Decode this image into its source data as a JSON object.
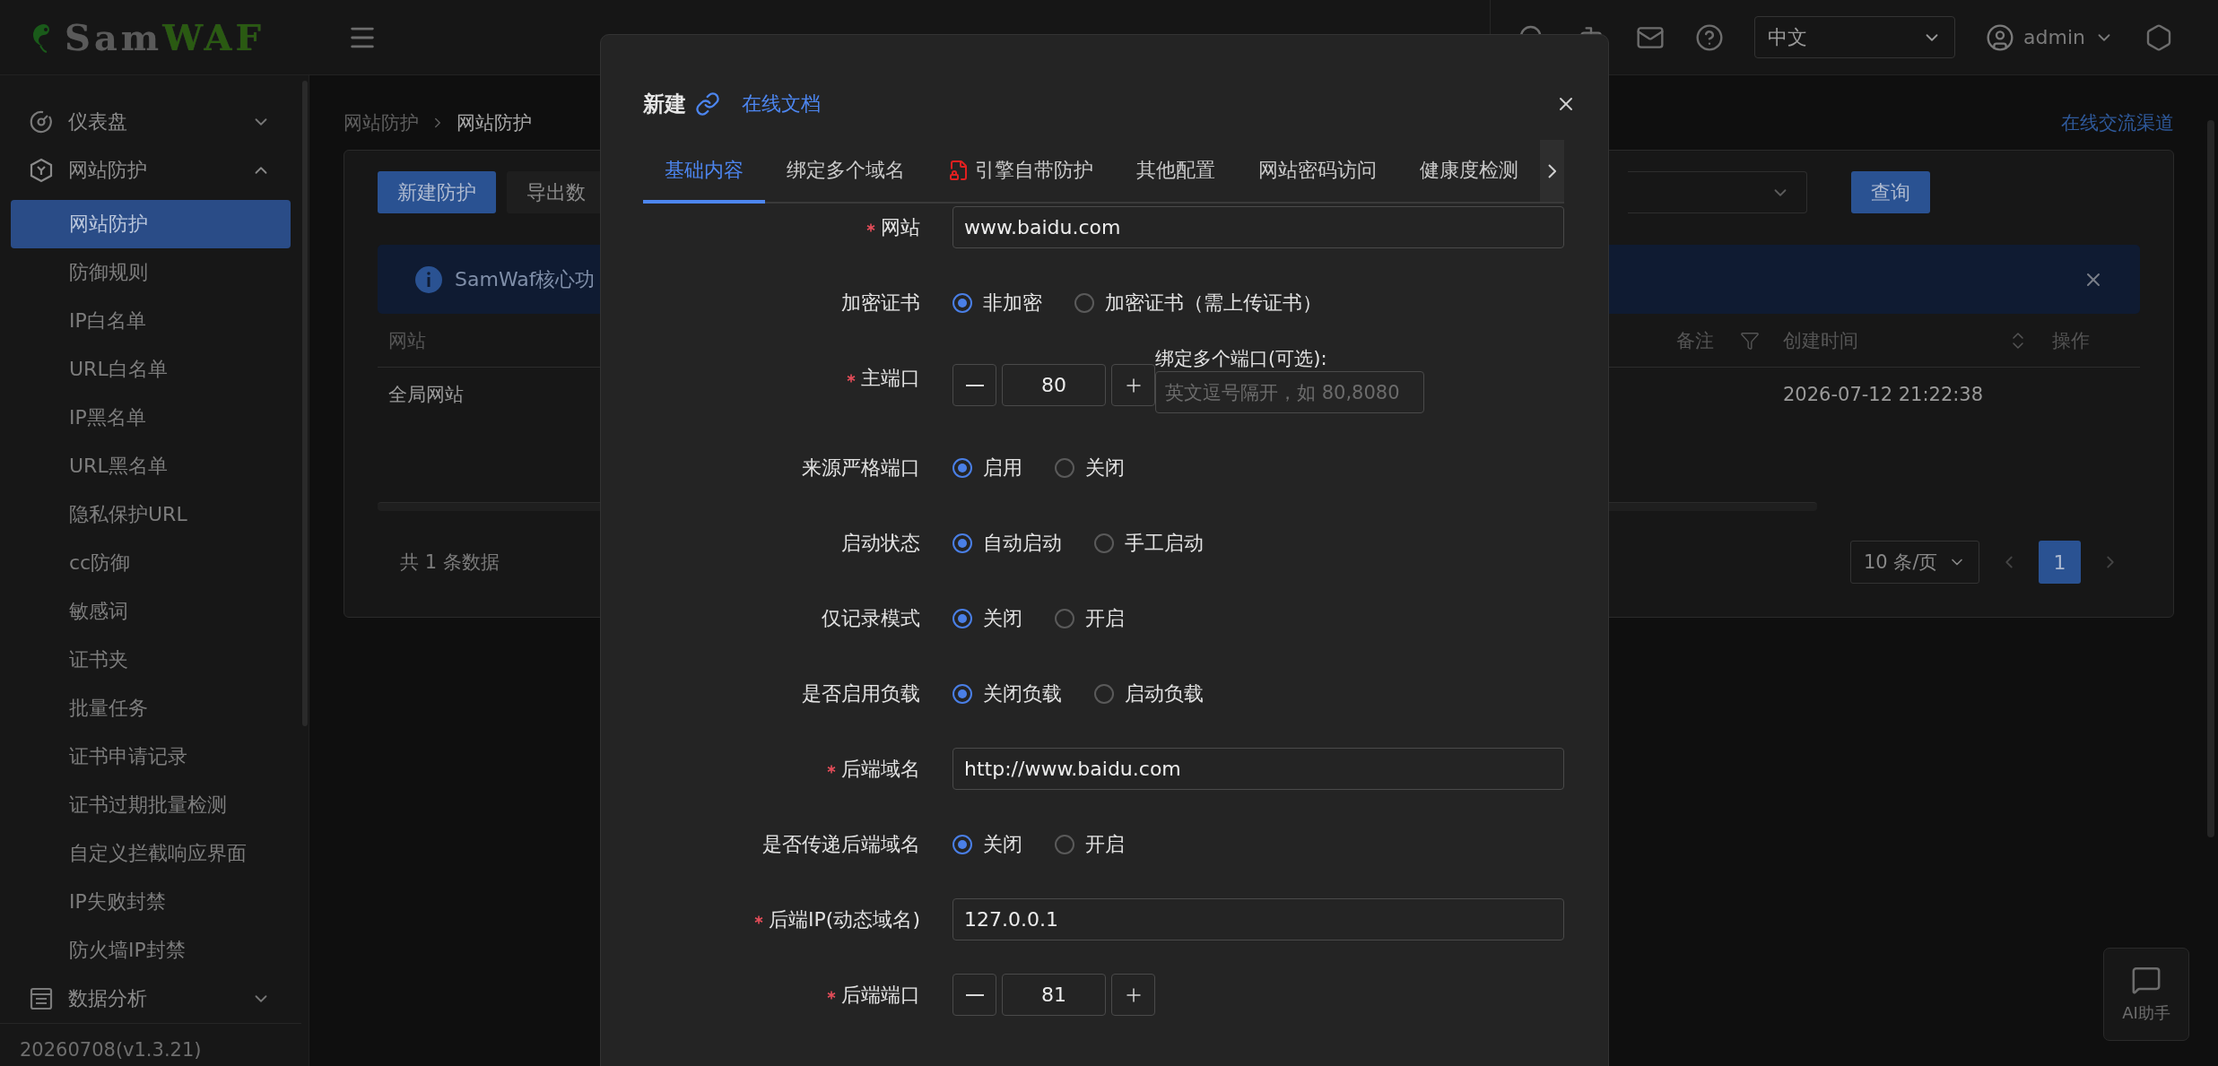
{
  "header": {
    "logo": {
      "part_1": "Sam",
      "part_2": "WAF"
    },
    "language": "中文",
    "user": "admin"
  },
  "sidebar": {
    "groups": [
      {
        "kind": "dashboard",
        "label": "仪表盘",
        "expanded": false
      },
      {
        "kind": "protect",
        "label": "网站防护",
        "expanded": true,
        "items": [
          {
            "label": "网站防护",
            "selected": true
          },
          {
            "label": "防御规则",
            "selected": false
          },
          {
            "label": "IP白名单",
            "selected": false
          },
          {
            "label": "URL白名单",
            "selected": false
          },
          {
            "label": "IP黑名单",
            "selected": false
          },
          {
            "label": "URL黑名单",
            "selected": false
          },
          {
            "label": "隐私保护URL",
            "selected": false
          },
          {
            "label": "cc防御",
            "selected": false
          },
          {
            "label": "敏感词",
            "selected": false
          },
          {
            "label": "证书夹",
            "selected": false
          },
          {
            "label": "批量任务",
            "selected": false
          },
          {
            "label": "证书申请记录",
            "selected": false
          },
          {
            "label": "证书过期批量检测",
            "selected": false
          },
          {
            "label": "自定义拦截响应界面",
            "selected": false
          },
          {
            "label": "IP失败封禁",
            "selected": false
          },
          {
            "label": "防火墙IP封禁",
            "selected": false
          }
        ]
      },
      {
        "kind": "analysis",
        "label": "数据分析",
        "expanded": false
      }
    ],
    "version": "20260708(v1.3.21)"
  },
  "breadcrumb": [
    "网站防护",
    "网站防护"
  ],
  "community_link": "在线交流渠道",
  "toolbar": {
    "buttons": [
      {
        "label": "新建防护",
        "primary": true
      },
      {
        "label": "导出数",
        "primary": false
      }
    ],
    "query_button": "查询"
  },
  "alert": {
    "text": "SamWaf核心功"
  },
  "table": {
    "columns": [
      {
        "kind": "site",
        "label": "网站",
        "filter": false,
        "sortable": false
      },
      {
        "kind": "remark",
        "label": "备注",
        "filter": true,
        "sortable": false
      },
      {
        "kind": "created",
        "label": "创建时间",
        "filter": false,
        "sortable": true
      },
      {
        "kind": "ops",
        "label": "操作",
        "filter": false,
        "sortable": false
      }
    ],
    "rows": [
      {
        "site": "全局网站",
        "created": "2026-07-12 21:22:38"
      }
    ]
  },
  "pagination": {
    "total": "共 1 条数据",
    "page_size": "10 条/页",
    "pages": [
      {
        "label": "1",
        "selected": true
      }
    ]
  },
  "ai_helper": "AI助手",
  "modal": {
    "title": "新建",
    "doc_link": "在线文档",
    "tabs": [
      {
        "label": "基础内容",
        "selected": true,
        "alert": false
      },
      {
        "label": "绑定多个域名",
        "selected": false,
        "alert": false
      },
      {
        "label": "引擎自带防护",
        "selected": false,
        "alert": true
      },
      {
        "label": "其他配置",
        "selected": false,
        "alert": false
      },
      {
        "label": "网站密码访问",
        "selected": false,
        "alert": false
      },
      {
        "label": "健康度检测",
        "selected": false,
        "alert": false
      }
    ],
    "fields": [
      {
        "kind": "text",
        "label": "网站",
        "required": true,
        "value": "www.baidu.com"
      },
      {
        "kind": "radio",
        "label": "加密证书",
        "required": false,
        "options": [
          {
            "label": "非加密",
            "selected": true
          },
          {
            "label": "加密证书（需上传证书）",
            "selected": false
          }
        ]
      },
      {
        "kind": "number",
        "label": "主端口",
        "required": true,
        "value": "80",
        "extra": {
          "label": "绑定多个端口(可选):",
          "placeholder": "英文逗号隔开，如 80,8080"
        }
      },
      {
        "kind": "radio",
        "label": "来源严格端口",
        "required": false,
        "options": [
          {
            "label": "启用",
            "selected": true
          },
          {
            "label": "关闭",
            "selected": false
          }
        ]
      },
      {
        "kind": "radio",
        "label": "启动状态",
        "required": false,
        "options": [
          {
            "label": "自动启动",
            "selected": true
          },
          {
            "label": "手工启动",
            "selected": false
          }
        ]
      },
      {
        "kind": "radio",
        "label": "仅记录模式",
        "required": false,
        "options": [
          {
            "label": "关闭",
            "selected": true
          },
          {
            "label": "开启",
            "selected": false
          }
        ]
      },
      {
        "kind": "radio",
        "label": "是否启用负载",
        "required": false,
        "options": [
          {
            "label": "关闭负载",
            "selected": true
          },
          {
            "label": "启动负载",
            "selected": false
          }
        ]
      },
      {
        "kind": "text",
        "label": "后端域名",
        "required": true,
        "value": "http://www.baidu.com"
      },
      {
        "kind": "radio",
        "label": "是否传递后端域名",
        "required": false,
        "options": [
          {
            "label": "关闭",
            "selected": true
          },
          {
            "label": "开启",
            "selected": false
          }
        ]
      },
      {
        "kind": "text",
        "label": "后端IP(动态域名)",
        "required": true,
        "value": "127.0.0.1"
      },
      {
        "kind": "number",
        "label": "后端端口",
        "required": true,
        "value": "81"
      }
    ]
  }
}
